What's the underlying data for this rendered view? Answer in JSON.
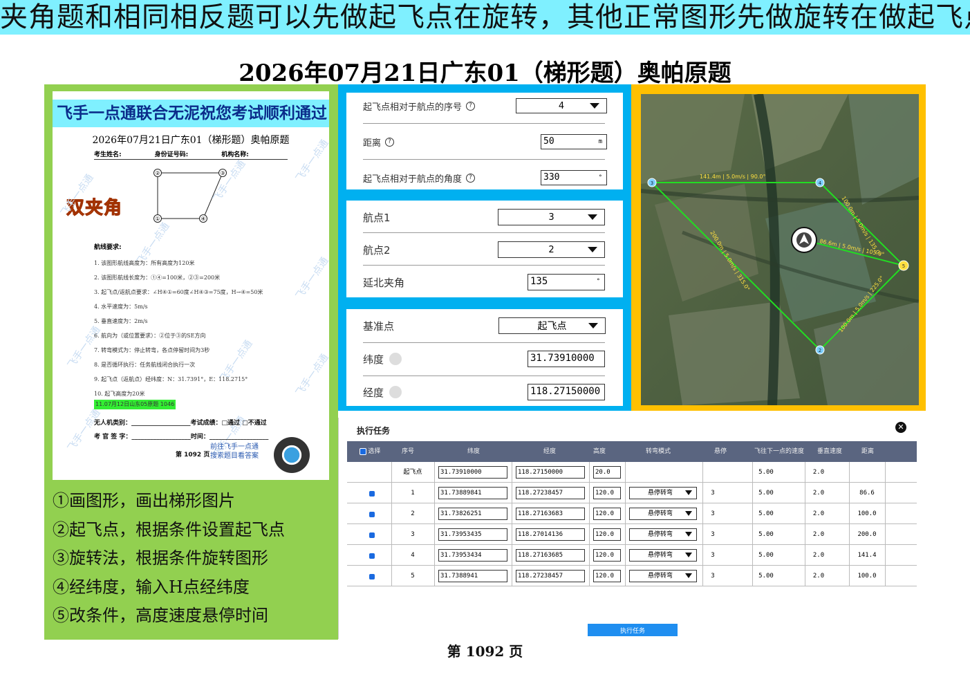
{
  "banner": "夹角题和相同相反题可以先做起飞点在旋转，其他正常图形先做旋转在做起飞点",
  "main_title": "2026年07月21日广东01（梯形题）奥帕原题",
  "paper": {
    "banner": "飞手一点通联合无泥祝您考试顺利通过",
    "title": "2026年07月21日广东01（梯形题）奥帕原题",
    "fields": [
      "考生姓名:",
      "身份证号码:",
      "机构名称:"
    ],
    "points": [
      "②",
      "③",
      "①",
      "④"
    ],
    "twin_angle": "双夹角",
    "req_title": "航线要求:",
    "requirements": [
      "1. 该图形航线高度为：所有高度为120米",
      "2. 该图形航线长度为：①④=100米，②③=200米",
      "3. 起飞点/返航点要求：∠H④①=60度∠H④③=75度，H→④=50米",
      "4. 水平速度为：5m/s",
      "5. 垂直速度为：2m/s",
      "6. 航向为（或位置要求）：②位于③的SE方向",
      "7. 转弯模式为：停止转弯，各点停留时间为3秒",
      "8. 是否循环执行：任务航线闭合执行一次",
      "9. 起飞点（返航点）经纬度：N：31.7391°，E：118.2715°",
      "10. 起飞高度为20米"
    ],
    "green_note": "11.07月12日山东05原题 1046",
    "uav_class": "无人机类别：___________________考试成绩：□通过  □不通过",
    "examiner": "考 官 签 字：___________________时间：___________________",
    "foot": "第 1092 页",
    "link_line1": "前往飞手一点通",
    "link_line2": "搜索题目看答案",
    "watermark": "飞手一点通"
  },
  "steps": [
    "①画图形，画出梯形图片",
    "②起飞点，根据条件设置起飞点",
    "③旋转法，根据条件旋转图形",
    "④经纬度，输入H点经纬度",
    "⑤改条件，高度速度悬停时间"
  ],
  "takeoff_card": {
    "seq_label": "起飞点相对于航点的序号",
    "seq_value": "4",
    "dist_label": "距离",
    "dist_value": "50",
    "dist_unit": "m",
    "angle_label": "起飞点相对于航点的角度",
    "angle_value": "330",
    "angle_unit": "°"
  },
  "angle_card": {
    "wp1_label": "航点1",
    "wp1_value": "3",
    "wp2_label": "航点2",
    "wp2_value": "2",
    "north_label": "延北夹角",
    "north_value": "135",
    "north_unit": "°"
  },
  "ref_card": {
    "ref_label": "基准点",
    "ref_value": "起飞点",
    "lat_label": "纬度",
    "lat_value": "31.73910000",
    "lon_label": "经度",
    "lon_value": "118.27150000"
  },
  "map": {
    "labels": [
      "141.4m | 5.0m/s | 90.0°",
      "100.0m | 5.0m/s | 135.0°",
      "200.0m | 5.0m/s | 315.0°",
      "86.6m | 5.0m/s | 105.0°",
      "100.0m | 5.0m/s | 225.0°"
    ],
    "points": [
      "3",
      "4",
      "5",
      "2"
    ]
  },
  "task": {
    "title": "执行任务",
    "close": "✕",
    "headers": [
      "选择",
      "序号",
      "纬度",
      "经度",
      "高度",
      "转弯模式",
      "悬停",
      "飞往下一点的速度",
      "垂直速度",
      "距离"
    ],
    "takeoff_row": {
      "seq": "起飞点",
      "lat": "31.73910000",
      "lon": "118.27150000",
      "alt": "20.0",
      "speed": "5.00",
      "vspeed": "2.0"
    },
    "rows": [
      {
        "seq": "1",
        "lat": "31.73889841",
        "lon": "118.27238457",
        "alt": "120.0",
        "turn": "悬停转弯",
        "hover": "3",
        "speed": "5.00",
        "vspeed": "2.0",
        "dist": "86.6"
      },
      {
        "seq": "2",
        "lat": "31.73826251",
        "lon": "118.27163683",
        "alt": "120.0",
        "turn": "悬停转弯",
        "hover": "3",
        "speed": "5.00",
        "vspeed": "2.0",
        "dist": "100.0"
      },
      {
        "seq": "3",
        "lat": "31.73953435",
        "lon": "118.27014136",
        "alt": "120.0",
        "turn": "悬停转弯",
        "hover": "3",
        "speed": "5.00",
        "vspeed": "2.0",
        "dist": "200.0"
      },
      {
        "seq": "4",
        "lat": "31.73953434",
        "lon": "118.27163685",
        "alt": "120.0",
        "turn": "悬停转弯",
        "hover": "3",
        "speed": "5.00",
        "vspeed": "2.0",
        "dist": "141.4"
      },
      {
        "seq": "5",
        "lat": "31.7388941",
        "lon": "118.27238457",
        "alt": "120.0",
        "turn": "悬停转弯",
        "hover": "3",
        "speed": "5.00",
        "vspeed": "2.0",
        "dist": "100.0"
      }
    ],
    "exec_button": "执行任务"
  },
  "page_num": "第 1092 页",
  "colors": {
    "banner": "#7ff0ff",
    "green": "#92d050",
    "blue": "#00b0f0",
    "yellow": "#ffc000",
    "route": "#22dd22"
  }
}
